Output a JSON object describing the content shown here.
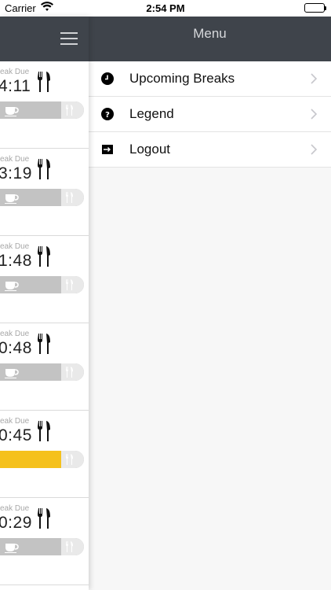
{
  "status_bar": {
    "carrier": "Carrier",
    "time": "2:54 PM"
  },
  "menu": {
    "title": "Menu",
    "items": [
      {
        "label": "Upcoming Breaks",
        "icon": "clock-icon"
      },
      {
        "label": "Legend",
        "icon": "question-icon"
      },
      {
        "label": "Logout",
        "icon": "logout-icon"
      }
    ]
  },
  "breaks": [
    {
      "due_label": "eak Due",
      "time": "4:11",
      "progress": 0
    },
    {
      "due_label": "eak Due",
      "time": "3:19",
      "progress": 0
    },
    {
      "due_label": "eak Due",
      "time": "1:48",
      "progress": 0
    },
    {
      "due_label": "eak Due",
      "time": "0:48",
      "progress": 0
    },
    {
      "due_label": "eak Due",
      "time": "0:45",
      "progress": 0.74
    },
    {
      "due_label": "eak Due",
      "time": "0:29",
      "progress": 0
    }
  ],
  "colors": {
    "header": "#3f444b",
    "accent": "#f5c11c",
    "bar": "#c3c3c3"
  }
}
